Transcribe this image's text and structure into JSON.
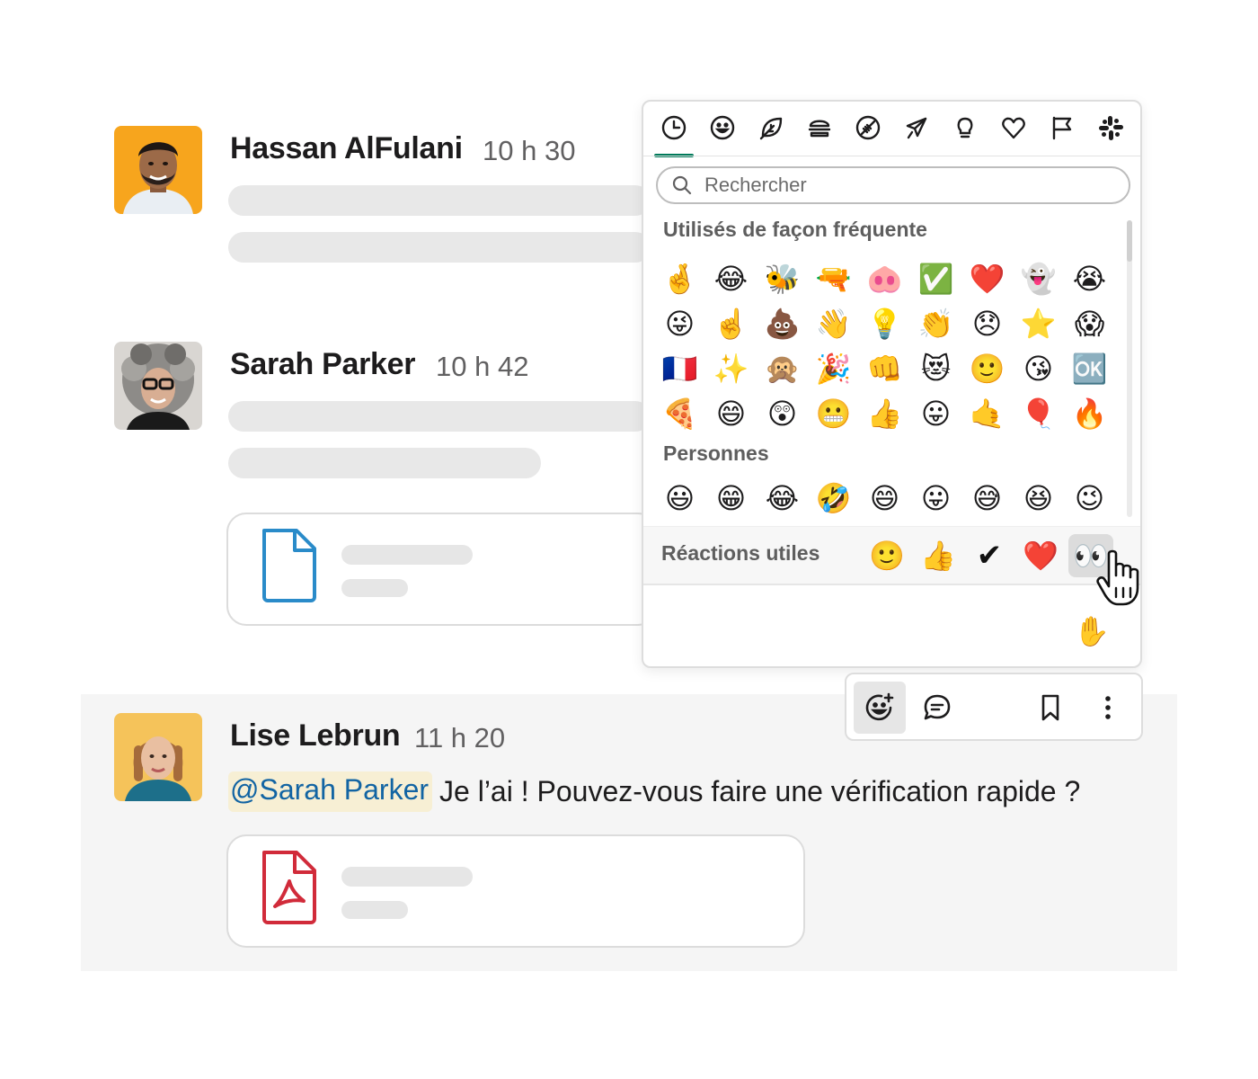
{
  "messages": [
    {
      "author": "Hassan AlFulani",
      "time": "10 h 30"
    },
    {
      "author": "Sarah Parker",
      "time": "10 h 42"
    },
    {
      "author": "Lise Lebrun",
      "time": "11 h 20",
      "mention": "@Sarah Parker",
      "text": "Je l’ai ! Pouvez-vous faire une vérification rapide ?"
    }
  ],
  "emoji_picker": {
    "categories": [
      "clock-icon",
      "smiley-icon",
      "leaf-icon",
      "burger-icon",
      "ball-icon",
      "plane-icon",
      "bulb-icon",
      "heart-icon",
      "flag-icon",
      "slack-icon"
    ],
    "search_placeholder": "Rechercher",
    "frequent_title": "Utilisés de façon fréquente",
    "frequent": [
      "🤞",
      "😂",
      "🐝",
      "🔫",
      "🐽",
      "✅",
      "❤️",
      "👻",
      "😭",
      "😜",
      "☝️",
      "💩",
      "👋",
      "💡",
      "👏",
      "😞",
      "⭐",
      "😱",
      "🇫🇷",
      "✨",
      "🙊",
      "🎉",
      "👊",
      "😻",
      "🙂",
      "😘",
      "🆗",
      "🍕",
      "😄",
      "😲",
      "😬",
      "👍",
      "😛",
      "🤙",
      "🎈",
      "🔥"
    ],
    "people_title": "Personnes",
    "people": [
      "😃",
      "😁",
      "😂",
      "🤣",
      "😄",
      "😛",
      "😅",
      "😆",
      "😉"
    ],
    "quick_title": "Réactions utiles",
    "quick": [
      "🙂",
      "👍",
      "✔",
      "❤️",
      "👀"
    ],
    "skin_tone": "✋"
  },
  "colors": {
    "accent": "#007a5a",
    "mention_bg": "#f7efd4",
    "mention_text": "#1264a3",
    "file_doc": "#2a8bc9",
    "file_pdf": "#d12b3a"
  }
}
